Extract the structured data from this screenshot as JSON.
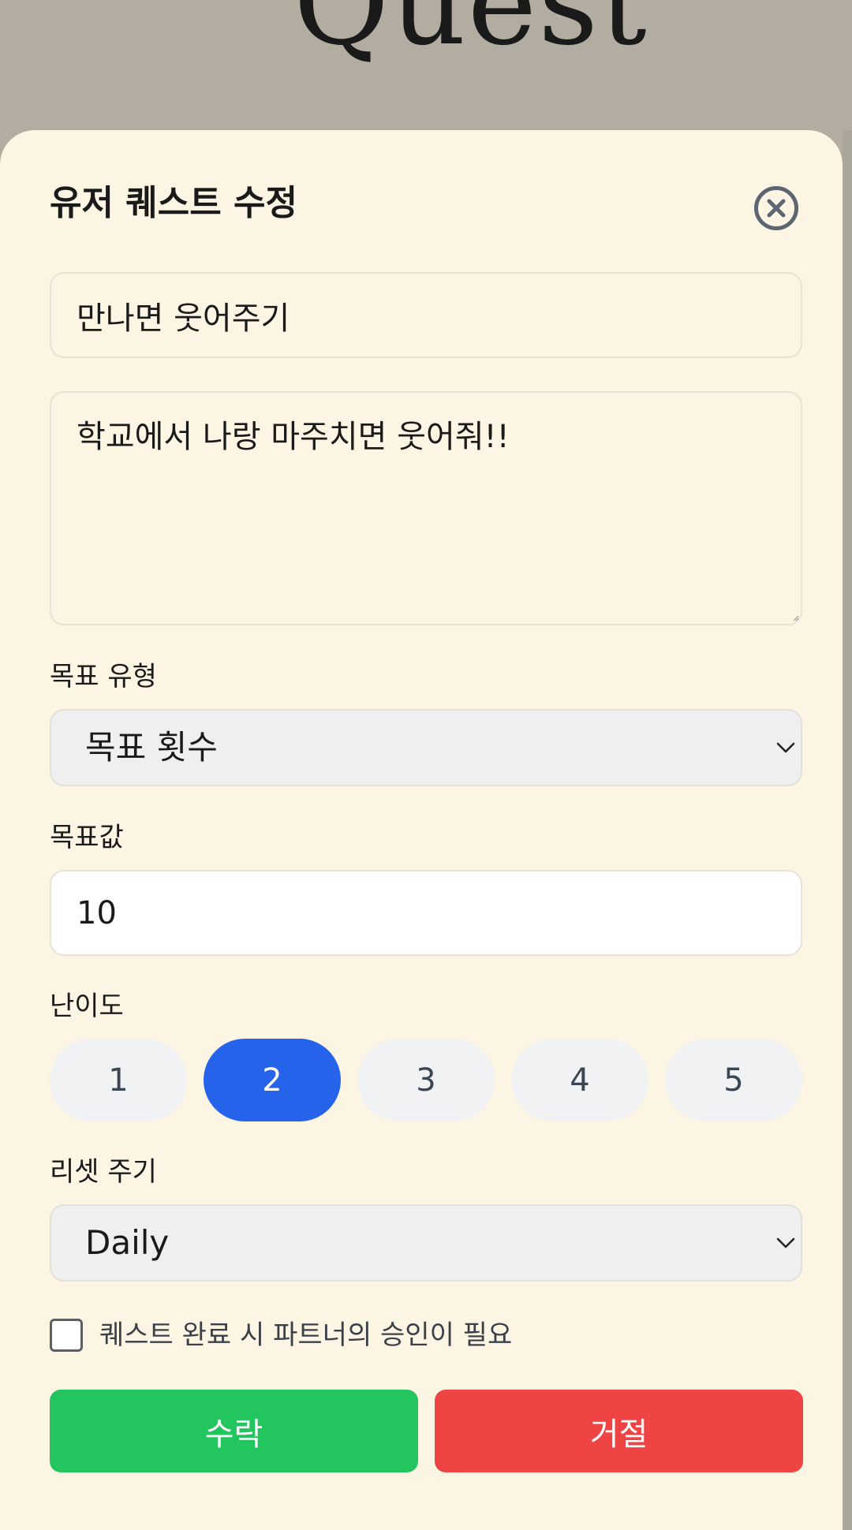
{
  "background": {
    "title": "Quest"
  },
  "modal": {
    "title": "유저 퀘스트 수정",
    "close_icon": "close-circle-icon",
    "quest_title_value": "만나면 웃어주기",
    "quest_description_value": "학교에서 나랑 마주치면 웃어줘!!",
    "goal_type": {
      "label": "목표 유형",
      "selected": "목표 횟수"
    },
    "goal_value": {
      "label": "목표값",
      "value": "10"
    },
    "difficulty": {
      "label": "난이도",
      "options": [
        "1",
        "2",
        "3",
        "4",
        "5"
      ],
      "selected": "2"
    },
    "reset_cycle": {
      "label": "리셋 주기",
      "selected": "Daily"
    },
    "partner_approval": {
      "label": "퀘스트 완료 시 파트너의 승인이 필요",
      "checked": false
    },
    "accept_label": "수락",
    "reject_label": "거절"
  },
  "colors": {
    "backdrop": "#b2ada0",
    "sheet": "#fcf5e4",
    "primary": "#2563eb",
    "accept": "#22c55e",
    "reject": "#ef4444"
  }
}
